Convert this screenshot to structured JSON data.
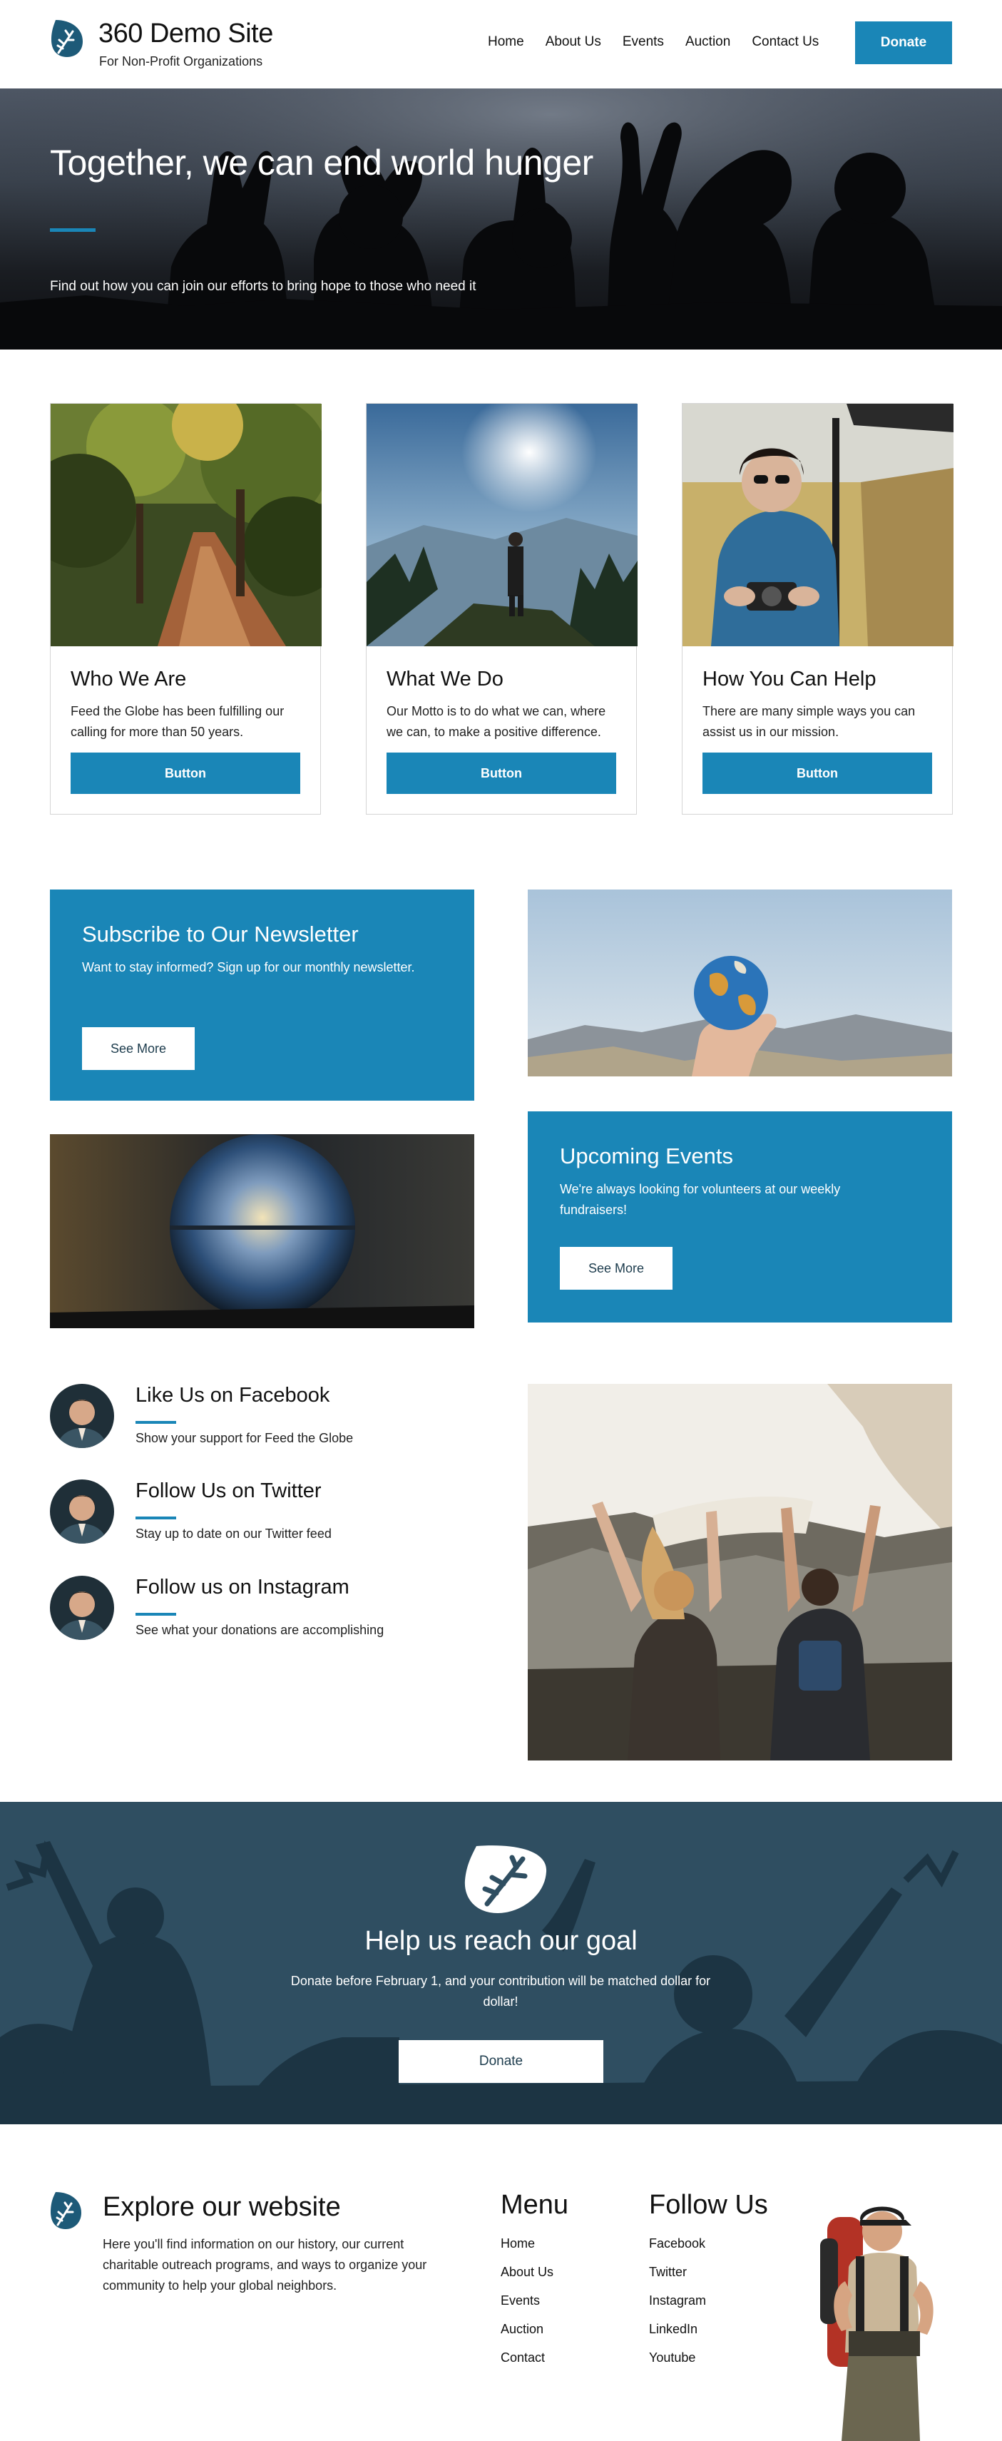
{
  "header": {
    "site_title": "360 Demo Site",
    "tagline": "For Non-Profit Organizations",
    "nav": [
      "Home",
      "About Us",
      "Events",
      "Auction",
      "Contact Us"
    ],
    "donate_label": "Donate"
  },
  "hero": {
    "title": "Together, we can end world hunger",
    "subtitle": "Find out how you can join our efforts to bring hope to those who need it"
  },
  "cards": [
    {
      "title": "Who We Are",
      "text": "Feed the Globe has been fulfilling our calling for more than 50 years.",
      "button": "Button"
    },
    {
      "title": "What We Do",
      "text": "Our Motto is to do what we can, where we can, to make a positive difference.",
      "button": "Button"
    },
    {
      "title": "How You Can Help",
      "text": "There are many simple ways you can assist us in our mission.",
      "button": "Button"
    }
  ],
  "newsletter": {
    "title": "Subscribe to Our Newsletter",
    "text": "Want to stay informed? Sign up for our monthly newsletter.",
    "button": "See More"
  },
  "events": {
    "title": "Upcoming Events",
    "text": "We're always looking for volunteers at our weekly fundraisers!",
    "button": "See More"
  },
  "social": [
    {
      "title": "Like Us on Facebook",
      "text": "Show your support for Feed the Globe"
    },
    {
      "title": "Follow Us on Twitter",
      "text": "Stay up to date on our Twitter feed"
    },
    {
      "title": "Follow us on Instagram",
      "text": "See what your donations are accomplishing"
    }
  ],
  "goal": {
    "title": "Help us reach our goal",
    "text": "Donate before February 1, and your contribution will be matched dollar for dollar!",
    "button": "Donate"
  },
  "footer": {
    "explore_title": "Explore our website",
    "explore_text": "Here you'll find information on our history, our current charitable outreach programs, and ways to organize your community to help your global neighbors.",
    "menu_title": "Menu",
    "menu_items": [
      "Home",
      "About Us",
      "Events",
      "Auction",
      "Contact"
    ],
    "follow_title": "Follow Us",
    "follow_items": [
      "Facebook",
      "Twitter",
      "Instagram",
      "LinkedIn",
      "Youtube"
    ]
  },
  "colors": {
    "accent": "#1a86b7",
    "goal_band": "#2f4e61",
    "dark_text": "#1d3c4d"
  }
}
